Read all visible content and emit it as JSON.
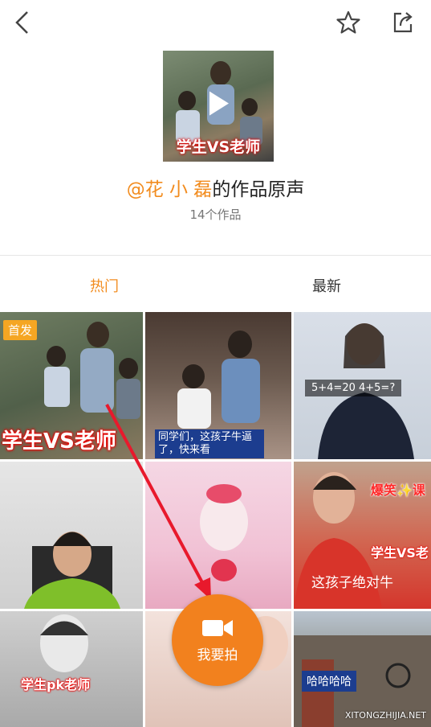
{
  "header": {
    "back_icon": "back-icon",
    "star_icon": "star-icon",
    "share_icon": "share-icon"
  },
  "sound": {
    "cover_caption": "学生VS老师",
    "user": "@花 小 磊",
    "title_suffix": "的作品原声",
    "works_count": "14个作品"
  },
  "tabs": {
    "hot": "热门",
    "latest": "最新"
  },
  "grid": {
    "badge_first": "首发",
    "cells": [
      {
        "caption": "学生VS老师"
      },
      {
        "caption": "同学们，这孩子牛逼了，快来看"
      },
      {
        "caption": "5+4=20 4+5=?"
      },
      {
        "caption": ""
      },
      {
        "caption": ""
      },
      {
        "caption": "这孩子绝对牛"
      },
      {
        "caption": "学生pk老师"
      },
      {
        "caption": ""
      },
      {
        "caption": "哈哈哈哈"
      }
    ],
    "cell6_top": "爆笑✨课",
    "cell6_mid": "学生VS老"
  },
  "record_button": {
    "label": "我要拍"
  },
  "watermark": "XITONGZHIJIA.NET",
  "colors": {
    "accent": "#f28c1f",
    "record": "#f2811e"
  }
}
